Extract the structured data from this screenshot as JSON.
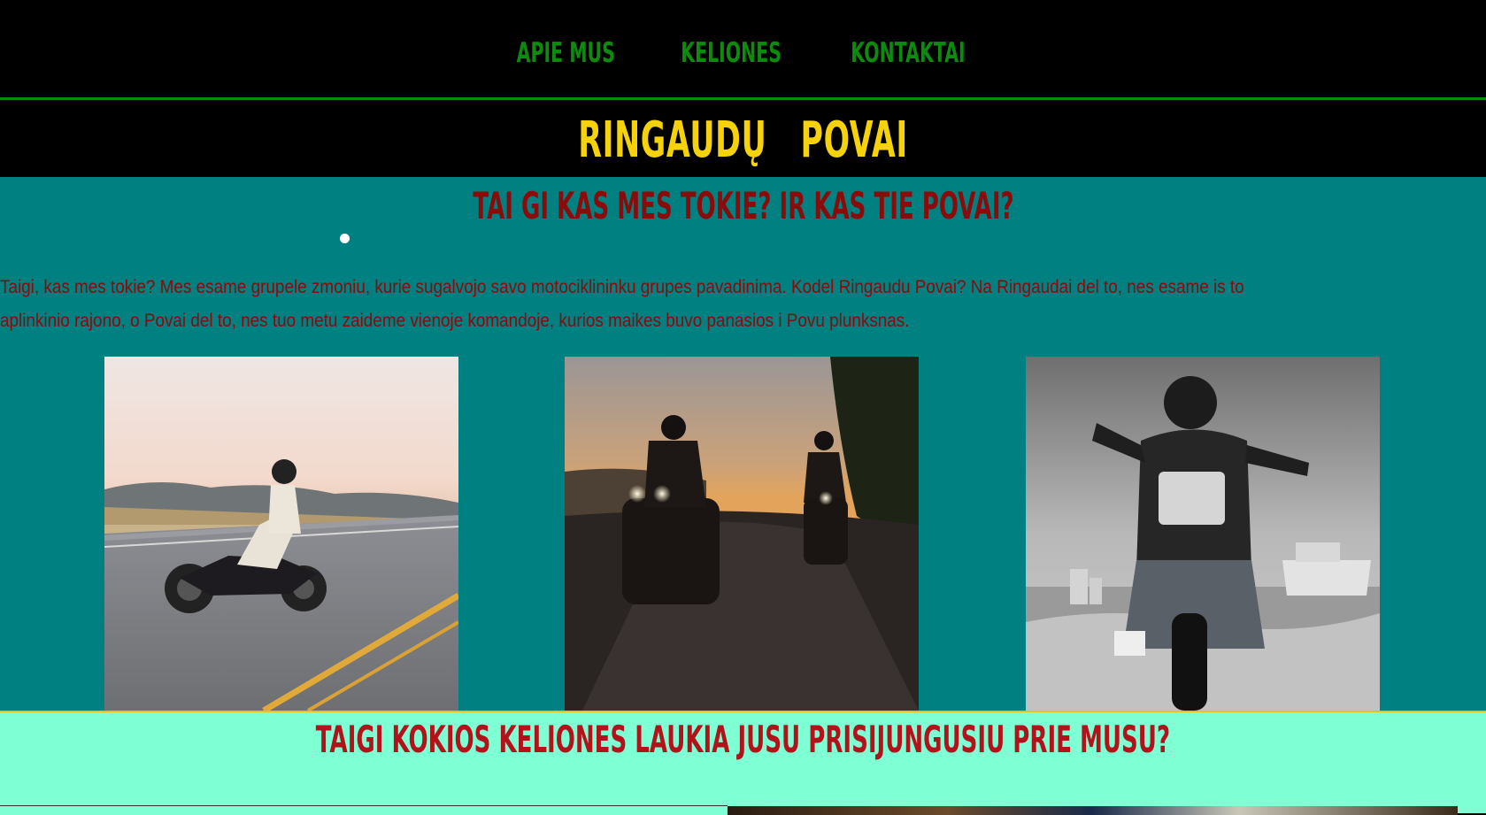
{
  "nav": {
    "items": [
      {
        "label": "APIE MUS"
      },
      {
        "label": "KELIONES"
      },
      {
        "label": "KONTAKTAI"
      }
    ]
  },
  "brand": {
    "title": "RINGAUDŲ   POVAI"
  },
  "about": {
    "heading": "TAI GI KAS MES TOKIE? IR KAS TIE POVAI?",
    "text_line1": "Taigi, kas mes tokie? Mes esame grupele zmoniu, kurie sugalvojo savo motociklininku grupes pavadinima. Kodel Ringaudu Povai? Na Ringaudai del to, nes esame is to",
    "text_line2": "aplinkinio rajono, o Povai del to, nes tuo metu zaideme vienoje komandoje, kurios maikes buvo panasios i Povu plunksnas."
  },
  "trips": {
    "heading": "TAIGI KOKIOS KELIONES LAUKIA JUSU PRISIJUNGUSIU PRIE MUSU?"
  },
  "colors": {
    "nav_link": "#0e8a0e",
    "brand": "#f5d20a",
    "about_bg": "#008080",
    "about_text": "#8b0a0a",
    "trips_bg": "#7fffd4",
    "trips_heading": "#b3121a"
  }
}
